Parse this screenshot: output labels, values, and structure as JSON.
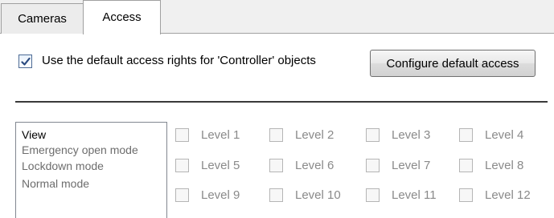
{
  "tabs": [
    {
      "label": "Cameras",
      "active": false
    },
    {
      "label": "Access",
      "active": true
    }
  ],
  "default_access": {
    "checked": true,
    "label": "Use the default access rights for 'Controller' objects",
    "button_label": "Configure default access"
  },
  "modes": [
    {
      "label": "View",
      "selected": true
    },
    {
      "label": "Emergency open mode",
      "selected": false
    },
    {
      "label": "Lockdown mode",
      "selected": false
    },
    {
      "label": "Normal mode",
      "selected": false
    }
  ],
  "levels": [
    {
      "label": "Level 1",
      "checked": false
    },
    {
      "label": "Level 2",
      "checked": false
    },
    {
      "label": "Level 3",
      "checked": false
    },
    {
      "label": "Level 4",
      "checked": false
    },
    {
      "label": "Level 5",
      "checked": false
    },
    {
      "label": "Level 6",
      "checked": false
    },
    {
      "label": "Level 7",
      "checked": false
    },
    {
      "label": "Level 8",
      "checked": false
    },
    {
      "label": "Level 9",
      "checked": false
    },
    {
      "label": "Level 10",
      "checked": false
    },
    {
      "label": "Level 11",
      "checked": false
    },
    {
      "label": "Level 12",
      "checked": false
    }
  ]
}
